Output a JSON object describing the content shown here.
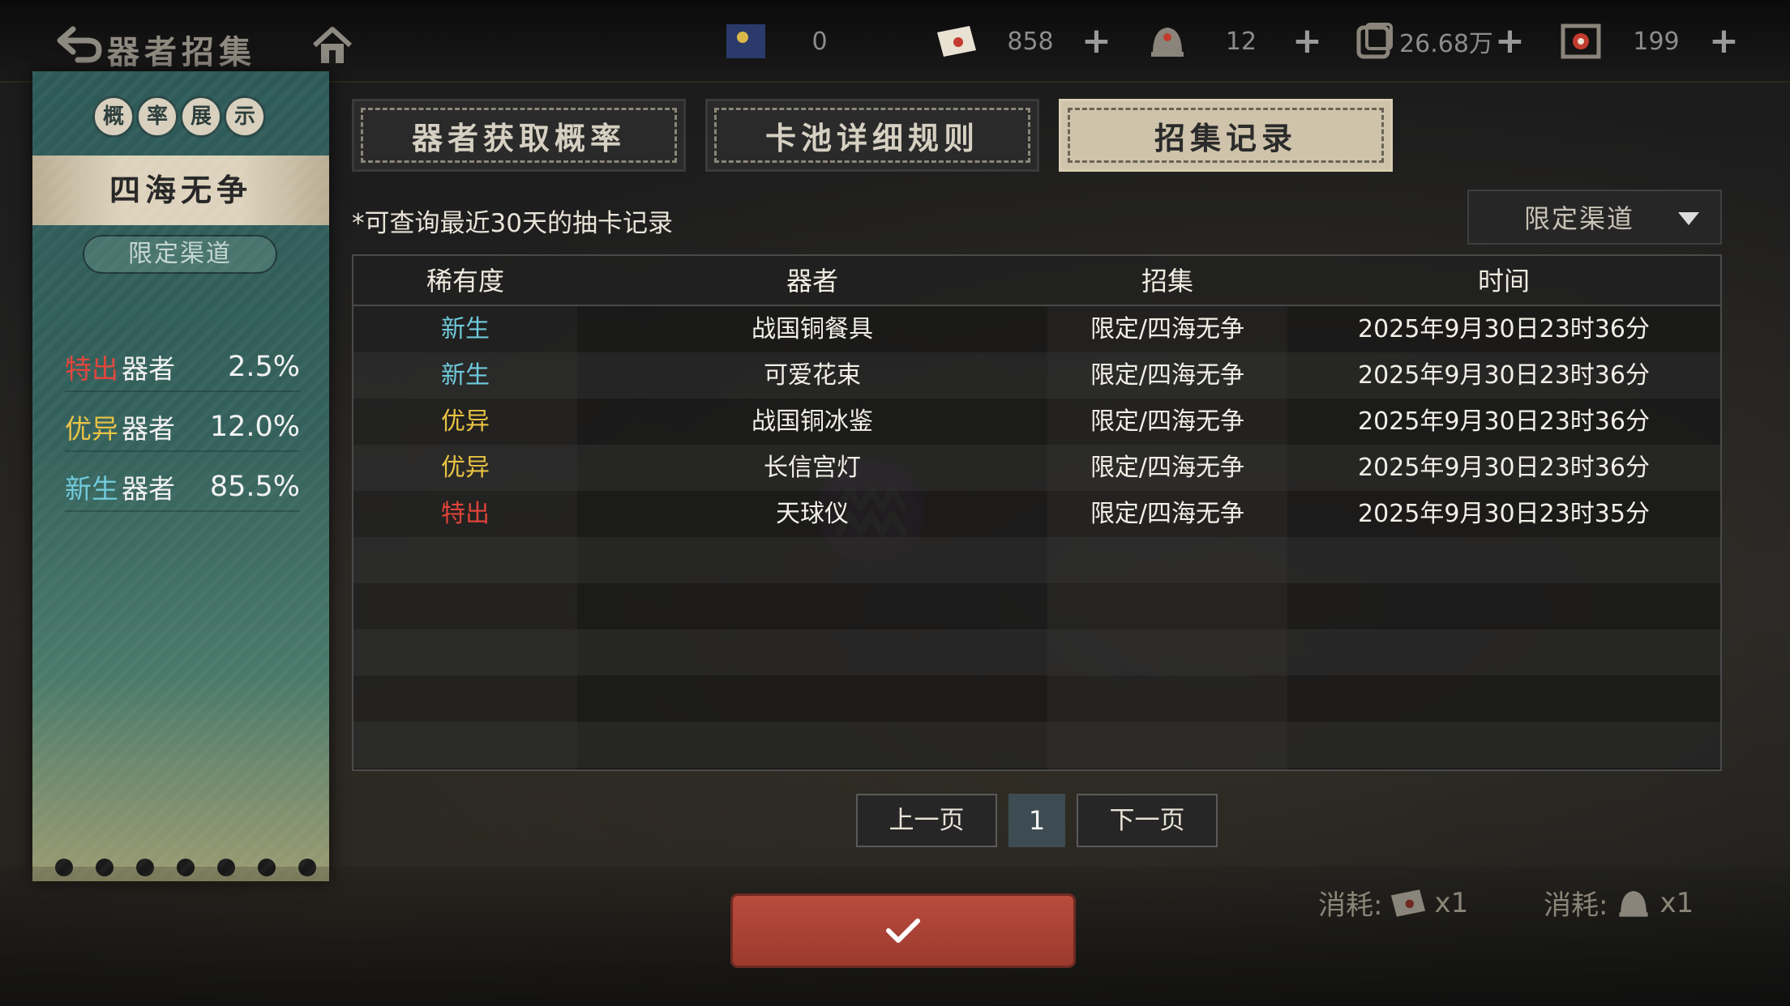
{
  "header": {
    "title": "器者招集",
    "resources": [
      {
        "icon": "flag-icon",
        "value": "0"
      },
      {
        "icon": "ticket-envelope-icon",
        "value": "858"
      },
      {
        "icon": "bell-token-icon",
        "value": "12"
      },
      {
        "icon": "scroll-coin-icon",
        "value": "26.68万"
      },
      {
        "icon": "target-token-icon",
        "value": "199"
      }
    ],
    "plus_label": "+"
  },
  "left_panel": {
    "title_chars": [
      "概",
      "率",
      "展",
      "示"
    ],
    "pool_name": "四海无争",
    "channel_label": "限定渠道",
    "rates": [
      {
        "tier": "特出",
        "noun": "器者",
        "pct": "2.5%"
      },
      {
        "tier": "优异",
        "noun": "器者",
        "pct": "12.0%"
      },
      {
        "tier": "新生",
        "noun": "器者",
        "pct": "85.5%"
      }
    ]
  },
  "tabs": [
    {
      "label": "器者获取概率"
    },
    {
      "label": "卡池详细规则"
    },
    {
      "label": "招集记录"
    }
  ],
  "note": "*可查询最近30天的抽卡记录",
  "filter": {
    "selected": "限定渠道"
  },
  "table": {
    "headers": [
      "稀有度",
      "器者",
      "招集",
      "时间"
    ],
    "rows": [
      {
        "rarity": "新生",
        "item": "战国铜餐具",
        "pool": "限定/四海无争",
        "time": "2025年9月30日23时36分"
      },
      {
        "rarity": "新生",
        "item": "可爱花束",
        "pool": "限定/四海无争",
        "time": "2025年9月30日23时36分"
      },
      {
        "rarity": "优异",
        "item": "战国铜冰鉴",
        "pool": "限定/四海无争",
        "time": "2025年9月30日23时36分"
      },
      {
        "rarity": "优异",
        "item": "长信宫灯",
        "pool": "限定/四海无争",
        "time": "2025年9月30日23时36分"
      },
      {
        "rarity": "特出",
        "item": "天球仪",
        "pool": "限定/四海无争",
        "time": "2025年9月30日23时35分"
      }
    ]
  },
  "pagination": {
    "prev": "上一页",
    "page": "1",
    "next": "下一页"
  },
  "bottom": {
    "cost1": {
      "label": "消耗:",
      "qty": "x1"
    },
    "cost2": {
      "label": "消耗:",
      "qty": "x1"
    }
  },
  "colors": {
    "新生": "#6fcadb",
    "优异": "#e8c243",
    "特出": "#e0443a",
    "confirm": "#b84c3d"
  }
}
